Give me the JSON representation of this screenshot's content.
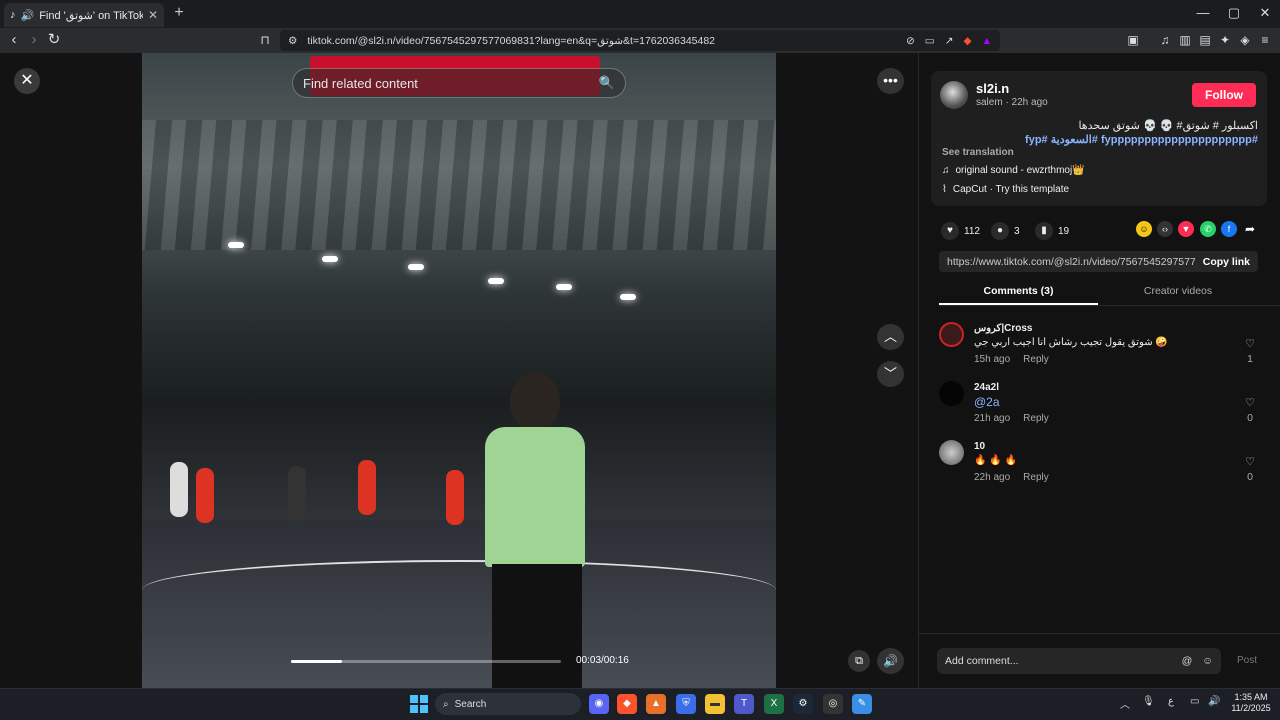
{
  "browser": {
    "tab_title": "Find 'شوتق' on TikTok | TikTok",
    "new_tab": "+",
    "url": "tiktok.com/@sl2i.n/video/7567545297577069831?lang=en&q=شوتق&t=1762036345482",
    "win_min": "—",
    "win_max": "▢",
    "win_close": "✕"
  },
  "video": {
    "search_placeholder": "Find related content",
    "time": "00:03/00:16",
    "progress": 0.19
  },
  "post": {
    "username": "sl2i.n",
    "subline": "salem · 22h ago",
    "follow": "Follow",
    "caption_plain": "اكسبلور # شوتق# 💀 💀 شوتق سحدها",
    "caption_tag1": "#fyppppppppppppppppppppp",
    "caption_tag2": "#السعودية",
    "caption_tag3": "#fyp",
    "see_translation": "See translation",
    "sound": "original sound - ewzrthmoj👑",
    "capcut": "CapCut · Try this template"
  },
  "stats": {
    "likes": "112",
    "comments": "3",
    "saves": "19"
  },
  "link": {
    "url": "https://www.tiktok.com/@sl2i.n/video/7567545297577...",
    "copy": "Copy link"
  },
  "tabs": {
    "comments": "Comments (3)",
    "creator": "Creator videos"
  },
  "comments": [
    {
      "name": "كروس|Cross",
      "text": "شوتق يقول تجيب رشاش انا اجيب اربي جي 🤪",
      "time": "15h ago",
      "reply": "Reply",
      "likes": "1"
    },
    {
      "name": "24a2l",
      "text": "@2a",
      "time": "21h ago",
      "reply": "Reply",
      "likes": "0"
    },
    {
      "name": "10",
      "text": "🔥 🔥 🔥",
      "time": "22h ago",
      "reply": "Reply",
      "likes": "0"
    }
  ],
  "composer": {
    "placeholder": "Add comment...",
    "post": "Post"
  },
  "taskbar": {
    "search": "Search",
    "lang": "ع",
    "time": "1:35 AM",
    "date": "11/2/2025"
  },
  "colors": {
    "accent": "#fe2c55",
    "hashtag": "#8ab4ff"
  }
}
